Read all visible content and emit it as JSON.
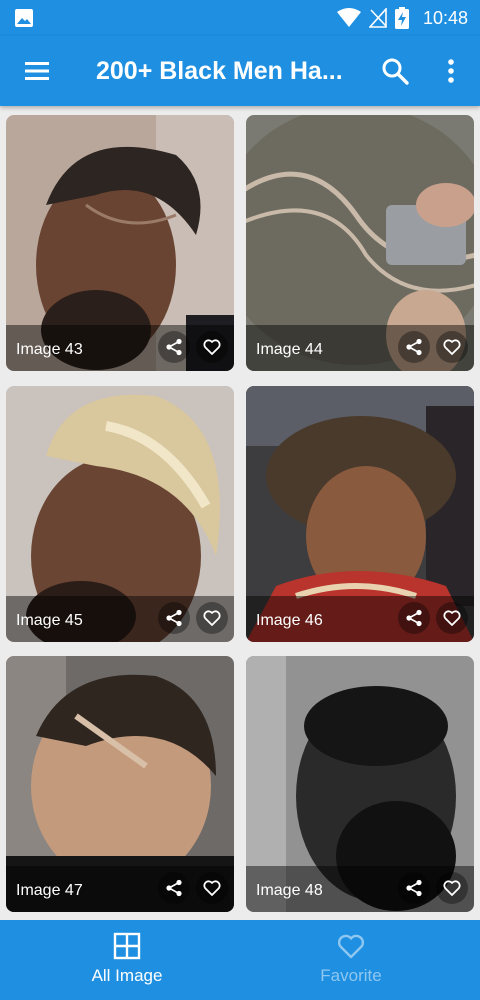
{
  "status_bar": {
    "time": "10:48"
  },
  "app_bar": {
    "title": "200+ Black Men Ha..."
  },
  "colors": {
    "primary": "#1e8fe1",
    "nav_inactive": "#8ec7f0"
  },
  "gallery": {
    "items": [
      {
        "label": "Image 43"
      },
      {
        "label": "Image 44"
      },
      {
        "label": "Image 45"
      },
      {
        "label": "Image 46"
      },
      {
        "label": "Image 47"
      },
      {
        "label": "Image 48"
      }
    ]
  },
  "bottom_nav": {
    "items": [
      {
        "label": "All Image",
        "icon": "grid-icon",
        "active": true
      },
      {
        "label": "Favorite",
        "icon": "heart-icon",
        "active": false
      }
    ]
  }
}
